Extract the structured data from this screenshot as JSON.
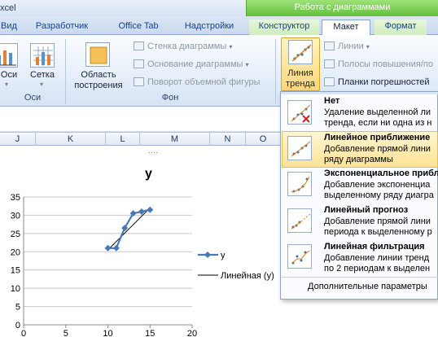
{
  "window": {
    "title": "xcel"
  },
  "context_header": "Работа с диаграммами",
  "tabs": [
    {
      "label": "Вид"
    },
    {
      "label": "Разработчик"
    },
    {
      "label": "Office Tab"
    },
    {
      "label": "Надстройки"
    },
    {
      "label": "Конструктор"
    },
    {
      "label": "Макет"
    },
    {
      "label": "Формат"
    }
  ],
  "ribbon": {
    "axes_btn": "Оси",
    "grid_btn": "Сетка",
    "axes_group": "Оси",
    "plot_area_btn": {
      "line1": "Область",
      "line2": "построения"
    },
    "chart_wall": "Стенка диаграммы",
    "chart_floor": "Основание диаграммы",
    "rotation_3d": "Поворот объемной фигуры",
    "bg_group": "Фон",
    "trendline_btn": {
      "line1": "Линия",
      "line2": "тренда"
    },
    "lines": "Линии",
    "updown_bars": "Полосы повышения/по",
    "error_bars": "Планки погрешностей"
  },
  "sheet": {
    "columns": [
      "J",
      "K",
      "L",
      "M",
      "N",
      "O"
    ]
  },
  "menu": {
    "items": [
      {
        "title": "Нет",
        "desc1": "Удаление выделенной ли",
        "desc2": "тренда, если ни одна из н"
      },
      {
        "title": "Линейное приближение",
        "desc1": "Добавление прямой лини",
        "desc2": "ряду диаграммы"
      },
      {
        "title": "Экспоненциальное прибл",
        "desc1": "Добавление экспоненциа",
        "desc2": "выделенному ряду диагра"
      },
      {
        "title": "Линейный прогноз",
        "desc1": "Добавление прямой лини",
        "desc2": "периода к выделенному р"
      },
      {
        "title": "Линейная фильтрация",
        "desc1": "Добавление линии тренд",
        "desc2": "по 2 периодам к выделен"
      }
    ],
    "more": "Дополнительные параметры"
  },
  "colors": {
    "series": "#4a78b5",
    "trend": "#000000",
    "highlight": "#ffe394"
  },
  "chart_data": {
    "type": "line",
    "title": "y",
    "xlim": [
      0,
      20
    ],
    "ylim": [
      0,
      35
    ],
    "x_ticks": [
      0,
      5,
      10,
      15,
      20
    ],
    "y_ticks": [
      0,
      5,
      10,
      15,
      20,
      25,
      30,
      35
    ],
    "series": [
      {
        "name": "y",
        "x": [
          10,
          11,
          12,
          13,
          14,
          15
        ],
        "y": [
          21,
          21,
          26.5,
          30.5,
          31,
          31.5
        ]
      }
    ],
    "trendline": {
      "name": "Линейная (y)",
      "from": [
        10,
        20.5
      ],
      "to": [
        15,
        32
      ]
    },
    "legend": "right"
  }
}
